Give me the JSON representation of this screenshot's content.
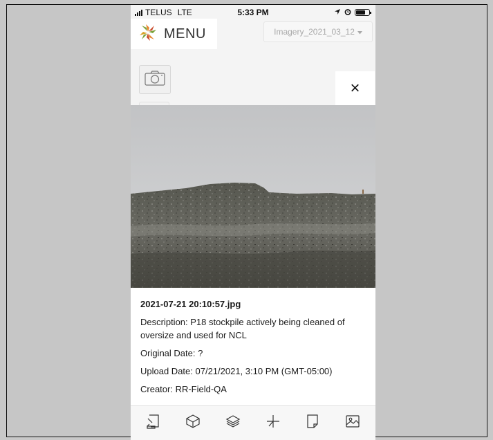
{
  "status_bar": {
    "carrier": "TELUS",
    "network": "LTE",
    "time": "5:33 PM"
  },
  "header": {
    "menu_label": "MENU",
    "imagery_select": "Imagery_2021_03_12"
  },
  "close_label": "×",
  "photo_info": {
    "filename": "2021-07-21 20:10:57.jpg",
    "description": "Description: P18 stockpile actively being cleaned of oversize and used for NCL",
    "original_date": "Original Date: ?",
    "upload_date": "Upload Date: 07/21/2021, 3:10 PM (GMT-05:00)",
    "creator": "Creator: RR-Field-QA"
  },
  "toolbar": {
    "icons": [
      "measure-icon",
      "cube-icon",
      "layers-icon",
      "axis-icon",
      "note-icon",
      "image-icon"
    ]
  },
  "colors": {
    "logo_orange": "#e8842c",
    "logo_green": "#7aa23a",
    "logo_red": "#c94b2b",
    "logo_gold": "#d9a329"
  }
}
